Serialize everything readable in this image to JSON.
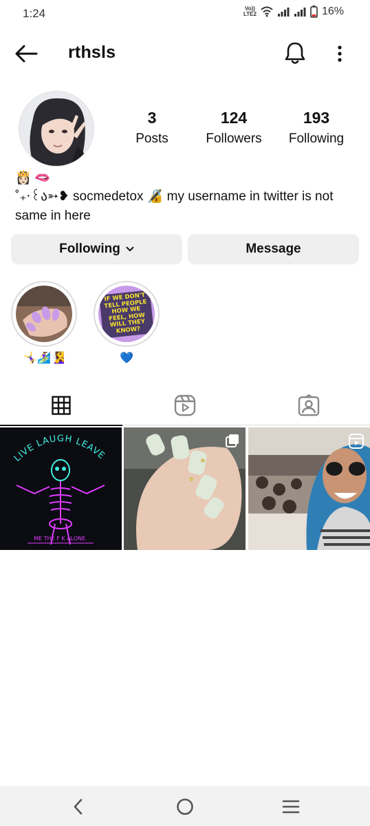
{
  "status_bar": {
    "time": "1:24",
    "volte_top": "Vo))",
    "volte_bottom": "LTE2",
    "battery": "16%"
  },
  "header": {
    "username": "rthsls",
    "icons": [
      "back-arrow-icon",
      "bell-icon",
      "more-vertical-icon"
    ]
  },
  "profile": {
    "stats": [
      {
        "count": "3",
        "label": "Posts"
      },
      {
        "count": "124",
        "label": "Followers"
      },
      {
        "count": "193",
        "label": "Following"
      }
    ],
    "bio_emoji": [
      "👸🏻",
      "🫦"
    ],
    "bio_text": "˚₊‧꒰ა➳❥ socmedetox 🔏 my username in twitter is not same in here",
    "following_button": "Following",
    "message_button": "Message"
  },
  "highlights": [
    {
      "label": "🤸‍♀️🏄‍♀️🧏‍♀️"
    },
    {
      "label": "💙",
      "cover_text": "IF WE DON'T TELL PEOPLE HOW WE FEEL, HOW WILL THEY KNOW?"
    }
  ],
  "tabs": [
    "grid-icon",
    "reels-icon",
    "tagged-icon"
  ],
  "posts": [
    {
      "top_text": "LIVE LAUGH LEAVE",
      "bottom_text": "ME THE F  K ALONE."
    },
    {
      "badge": "carousel-icon"
    },
    {
      "badge": "reel-icon"
    }
  ],
  "colors": {
    "button_bg": "#efefef",
    "neon_cyan": "#3ff0e0",
    "neon_pink": "#e03cff",
    "highlight_purple": "#c79be8",
    "highlight_yellow": "#f5e22c"
  }
}
